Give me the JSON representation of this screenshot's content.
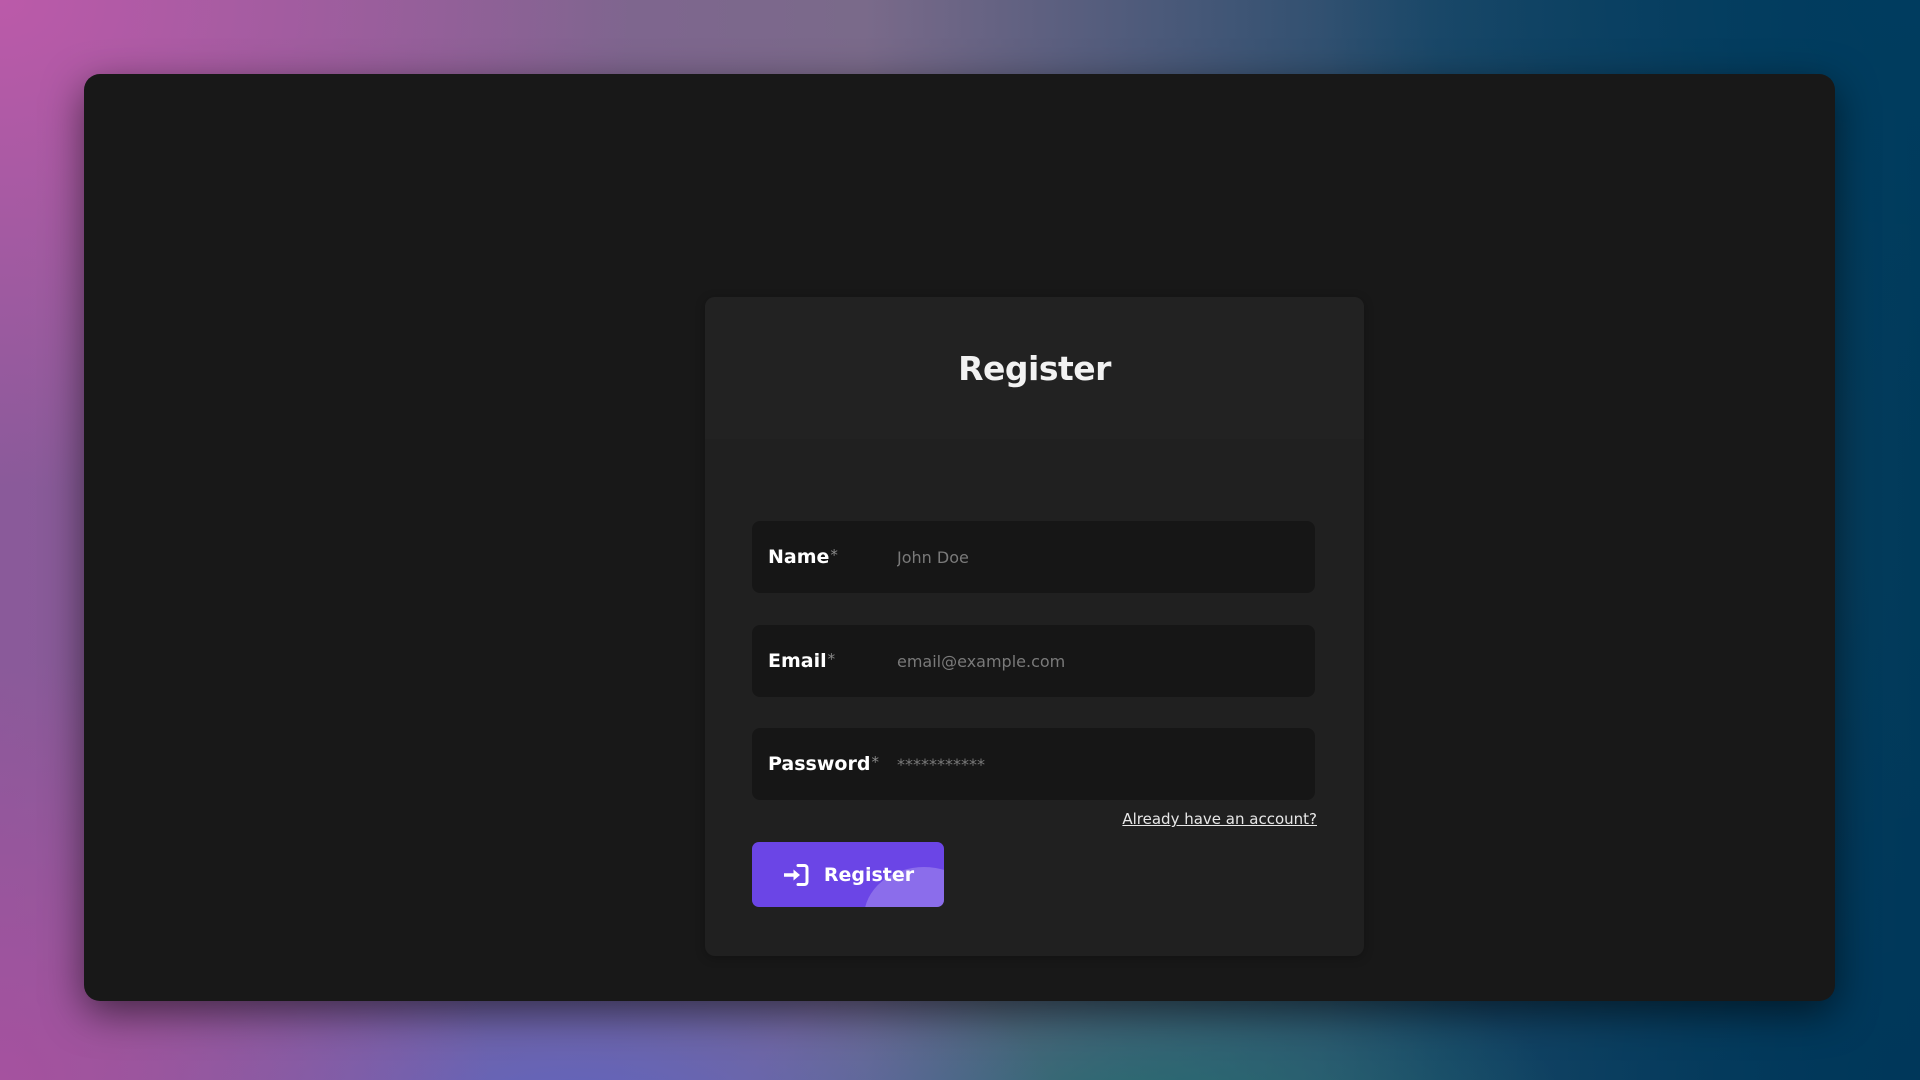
{
  "form": {
    "title": "Register",
    "fields": {
      "name": {
        "label": "Name",
        "required_mark": "*",
        "placeholder": "John Doe"
      },
      "email": {
        "label": "Email",
        "required_mark": "*",
        "placeholder": "email@example.com"
      },
      "password": {
        "label": "Password",
        "required_mark": "*",
        "placeholder": "***********"
      }
    },
    "signin_link": "Already have an account?",
    "submit_label": "Register",
    "submit_icon": "sign-in-icon"
  },
  "colors": {
    "accent": "#6b45e6",
    "frame_bg": "#181818",
    "card_bg": "#202020",
    "field_bg": "#161616"
  }
}
